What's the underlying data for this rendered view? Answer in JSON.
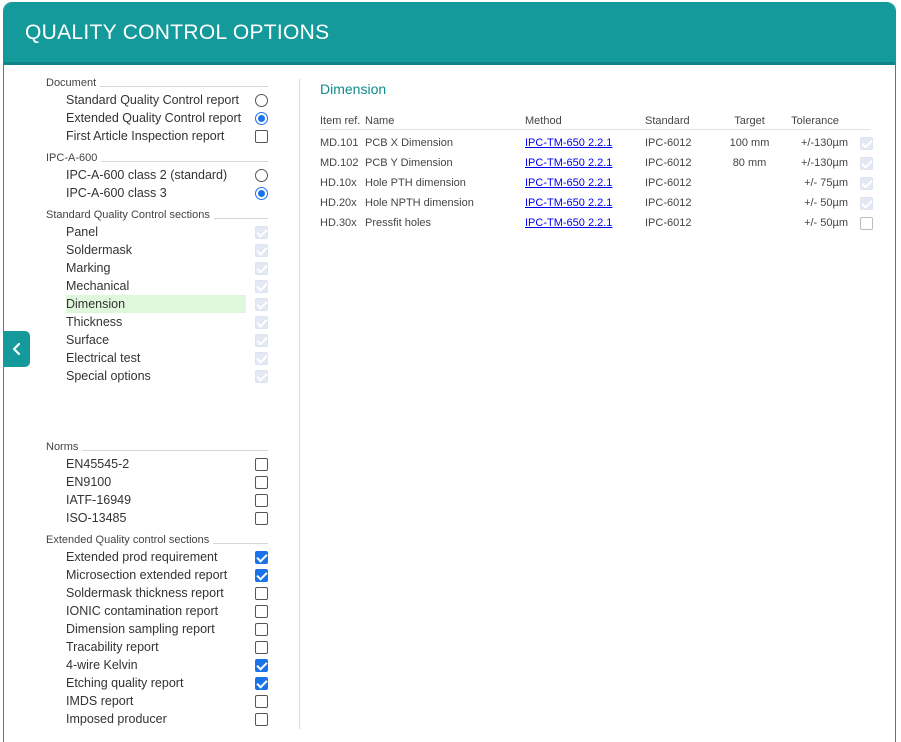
{
  "header": {
    "title": "QUALITY CONTROL OPTIONS"
  },
  "left": {
    "sections": [
      {
        "title": "Document",
        "items": [
          {
            "label": "Standard Quality Control report",
            "control": "radio",
            "checked": false,
            "disabled": false
          },
          {
            "label": "Extended Quality Control report",
            "control": "radio",
            "checked": true,
            "disabled": false
          },
          {
            "label": "First Article Inspection report",
            "control": "checkbox",
            "checked": false,
            "disabled": false
          }
        ]
      },
      {
        "title": "IPC-A-600",
        "items": [
          {
            "label": "IPC-A-600 class 2 (standard)",
            "control": "radio",
            "checked": false,
            "disabled": false
          },
          {
            "label": "IPC-A-600 class 3",
            "control": "radio",
            "checked": true,
            "disabled": false
          }
        ]
      },
      {
        "title": "Standard Quality Control sections",
        "items": [
          {
            "label": "Panel",
            "control": "checkbox",
            "checked": true,
            "disabled": true
          },
          {
            "label": "Soldermask",
            "control": "checkbox",
            "checked": true,
            "disabled": true
          },
          {
            "label": "Marking",
            "control": "checkbox",
            "checked": true,
            "disabled": true
          },
          {
            "label": "Mechanical",
            "control": "checkbox",
            "checked": true,
            "disabled": true
          },
          {
            "label": "Dimension",
            "control": "checkbox",
            "checked": true,
            "disabled": true,
            "highlight": true
          },
          {
            "label": "Thickness",
            "control": "checkbox",
            "checked": true,
            "disabled": true
          },
          {
            "label": "Surface",
            "control": "checkbox",
            "checked": true,
            "disabled": true
          },
          {
            "label": "Electrical test",
            "control": "checkbox",
            "checked": true,
            "disabled": true
          },
          {
            "label": "Special options",
            "control": "checkbox",
            "checked": true,
            "disabled": true
          }
        ]
      },
      {
        "title": "Norms",
        "items": [
          {
            "label": "EN45545-2",
            "control": "checkbox",
            "checked": false,
            "disabled": false
          },
          {
            "label": "EN9100",
            "control": "checkbox",
            "checked": false,
            "disabled": false
          },
          {
            "label": "IATF-16949",
            "control": "checkbox",
            "checked": false,
            "disabled": false
          },
          {
            "label": "ISO-13485",
            "control": "checkbox",
            "checked": false,
            "disabled": false
          }
        ]
      },
      {
        "title": "Extended Quality control sections",
        "items": [
          {
            "label": "Extended prod requirement",
            "control": "checkbox",
            "checked": true,
            "disabled": false
          },
          {
            "label": "Microsection extended report",
            "control": "checkbox",
            "checked": true,
            "disabled": false
          },
          {
            "label": "Soldermask thickness report",
            "control": "checkbox",
            "checked": false,
            "disabled": false
          },
          {
            "label": "IONIC contamination report",
            "control": "checkbox",
            "checked": false,
            "disabled": false
          },
          {
            "label": "Dimension sampling report",
            "control": "checkbox",
            "checked": false,
            "disabled": false
          },
          {
            "label": "Tracability report",
            "control": "checkbox",
            "checked": false,
            "disabled": false
          },
          {
            "label": "4-wire Kelvin",
            "control": "checkbox",
            "checked": true,
            "disabled": false
          },
          {
            "label": "Etching quality report",
            "control": "checkbox",
            "checked": true,
            "disabled": false
          },
          {
            "label": "IMDS report",
            "control": "checkbox",
            "checked": false,
            "disabled": false
          },
          {
            "label": "Imposed producer",
            "control": "checkbox",
            "checked": false,
            "disabled": false
          }
        ]
      }
    ]
  },
  "right": {
    "title": "Dimension",
    "columns": [
      "Item ref.",
      "Name",
      "Method",
      "Standard",
      "Target",
      "Tolerance"
    ],
    "rows": [
      {
        "ref": "MD.101",
        "name": "PCB X Dimension",
        "method": "IPC-TM-650 2.2.1",
        "standard": "IPC-6012",
        "target": "100 mm",
        "tolerance": "+/-130µm",
        "checked": true,
        "disabled": true
      },
      {
        "ref": "MD.102",
        "name": "PCB Y Dimension",
        "method": "IPC-TM-650 2.2.1",
        "standard": "IPC-6012",
        "target": "80 mm",
        "tolerance": "+/-130µm",
        "checked": true,
        "disabled": true
      },
      {
        "ref": "HD.10x",
        "name": "Hole PTH dimension",
        "method": "IPC-TM-650 2.2.1",
        "standard": "IPC-6012",
        "target": "",
        "tolerance": "+/- 75µm",
        "checked": true,
        "disabled": true
      },
      {
        "ref": "HD.20x",
        "name": "Hole NPTH dimension",
        "method": "IPC-TM-650 2.2.1",
        "standard": "IPC-6012",
        "target": "",
        "tolerance": "+/- 50µm",
        "checked": true,
        "disabled": true
      },
      {
        "ref": "HD.30x",
        "name": "Pressfit holes",
        "method": "IPC-TM-650 2.2.1",
        "standard": "IPC-6012",
        "target": "",
        "tolerance": "+/- 50µm",
        "checked": false,
        "disabled": true
      }
    ]
  },
  "colors": {
    "accent": "#159a9b",
    "highlight": "#dff7dc",
    "checkbox_on": "#1a73e8",
    "link": "#0000ee"
  }
}
